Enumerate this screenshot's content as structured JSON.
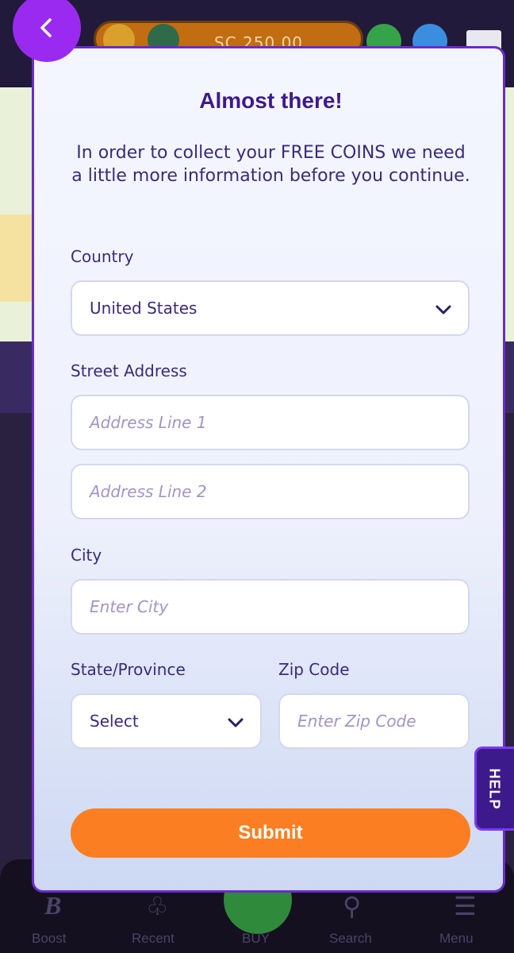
{
  "background": {
    "currency_text": "250.00",
    "currency_prefix": "SC",
    "nav_items": [
      {
        "label": "Boost",
        "icon": "boost-icon"
      },
      {
        "label": "Recent",
        "icon": "cherries-icon"
      },
      {
        "label": "BUY",
        "icon": "plus-icon"
      },
      {
        "label": "Search",
        "icon": "search-icon"
      },
      {
        "label": "Menu",
        "icon": "menu-icon"
      }
    ]
  },
  "back_button": {
    "icon": "chevron-left-icon"
  },
  "modal": {
    "title": "Almost there!",
    "subtitle": "In order to collect your FREE COINS we need a little more information before you continue.",
    "country": {
      "label": "Country",
      "value": "United States"
    },
    "street": {
      "label": "Street Address",
      "line1_placeholder": "Address Line 1",
      "line2_placeholder": "Address Line 2"
    },
    "city": {
      "label": "City",
      "placeholder": "Enter City"
    },
    "state": {
      "label": "State/Province",
      "value": "Select"
    },
    "zip": {
      "label": "Zip Code",
      "placeholder": "Enter Zip Code"
    },
    "submit_label": "Submit"
  },
  "help_tab": {
    "label": "HELP"
  },
  "colors": {
    "accent_purple": "#3d1a8c",
    "back_button": "#9b2af0",
    "submit": "#fb7f22"
  }
}
